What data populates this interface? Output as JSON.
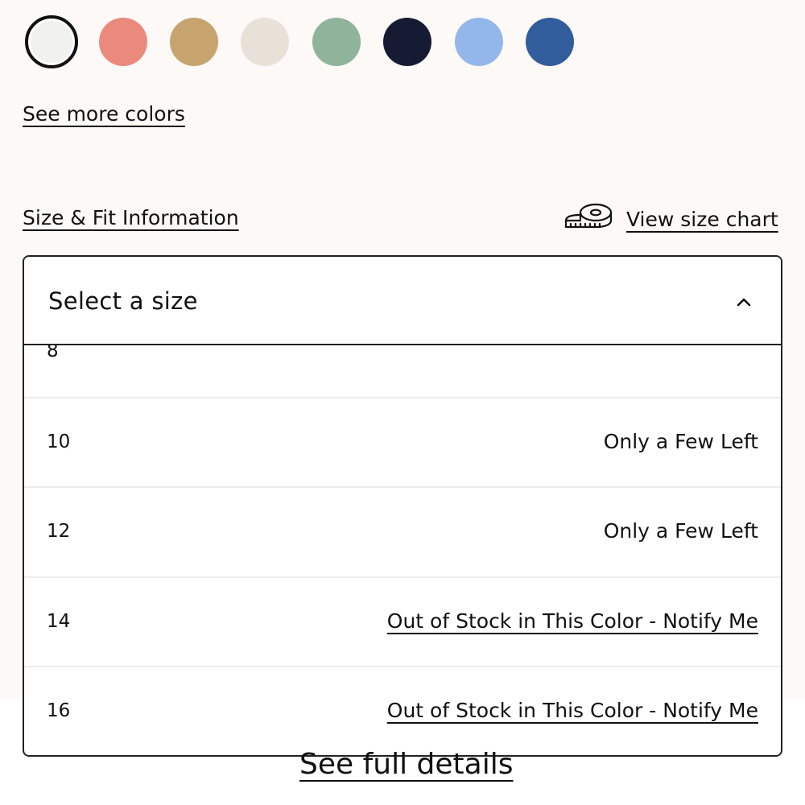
{
  "colors": {
    "swatches": [
      {
        "name": "white-swatch",
        "hex": "#f1f1f0",
        "selected": true
      },
      {
        "name": "coral-swatch",
        "hex": "#e98a7d"
      },
      {
        "name": "tan-swatch",
        "hex": "#c7a46e"
      },
      {
        "name": "cream-swatch",
        "hex": "#e8e1d8"
      },
      {
        "name": "sage-swatch",
        "hex": "#8fb39b"
      },
      {
        "name": "navy-swatch",
        "hex": "#141b33"
      },
      {
        "name": "light-blue-swatch",
        "hex": "#94b7ea"
      },
      {
        "name": "blue-swatch",
        "hex": "#325d9d"
      }
    ],
    "see_more_label": "See more colors"
  },
  "size_fit": {
    "info_label": "Size & Fit Information",
    "size_chart_label": "View size chart",
    "size_chart_icon": "measuring-tape-icon"
  },
  "size_select": {
    "placeholder": "Select a size",
    "expanded": true,
    "options": [
      {
        "size": "8",
        "status": ""
      },
      {
        "size": "10",
        "status": "Only a Few Left"
      },
      {
        "size": "12",
        "status": "Only a Few Left"
      },
      {
        "size": "14",
        "status": "Out of Stock in This Color - Notify Me"
      },
      {
        "size": "16",
        "status": "Out of Stock in This Color - Notify Me"
      }
    ]
  },
  "details": {
    "see_full_label": "See full details"
  }
}
